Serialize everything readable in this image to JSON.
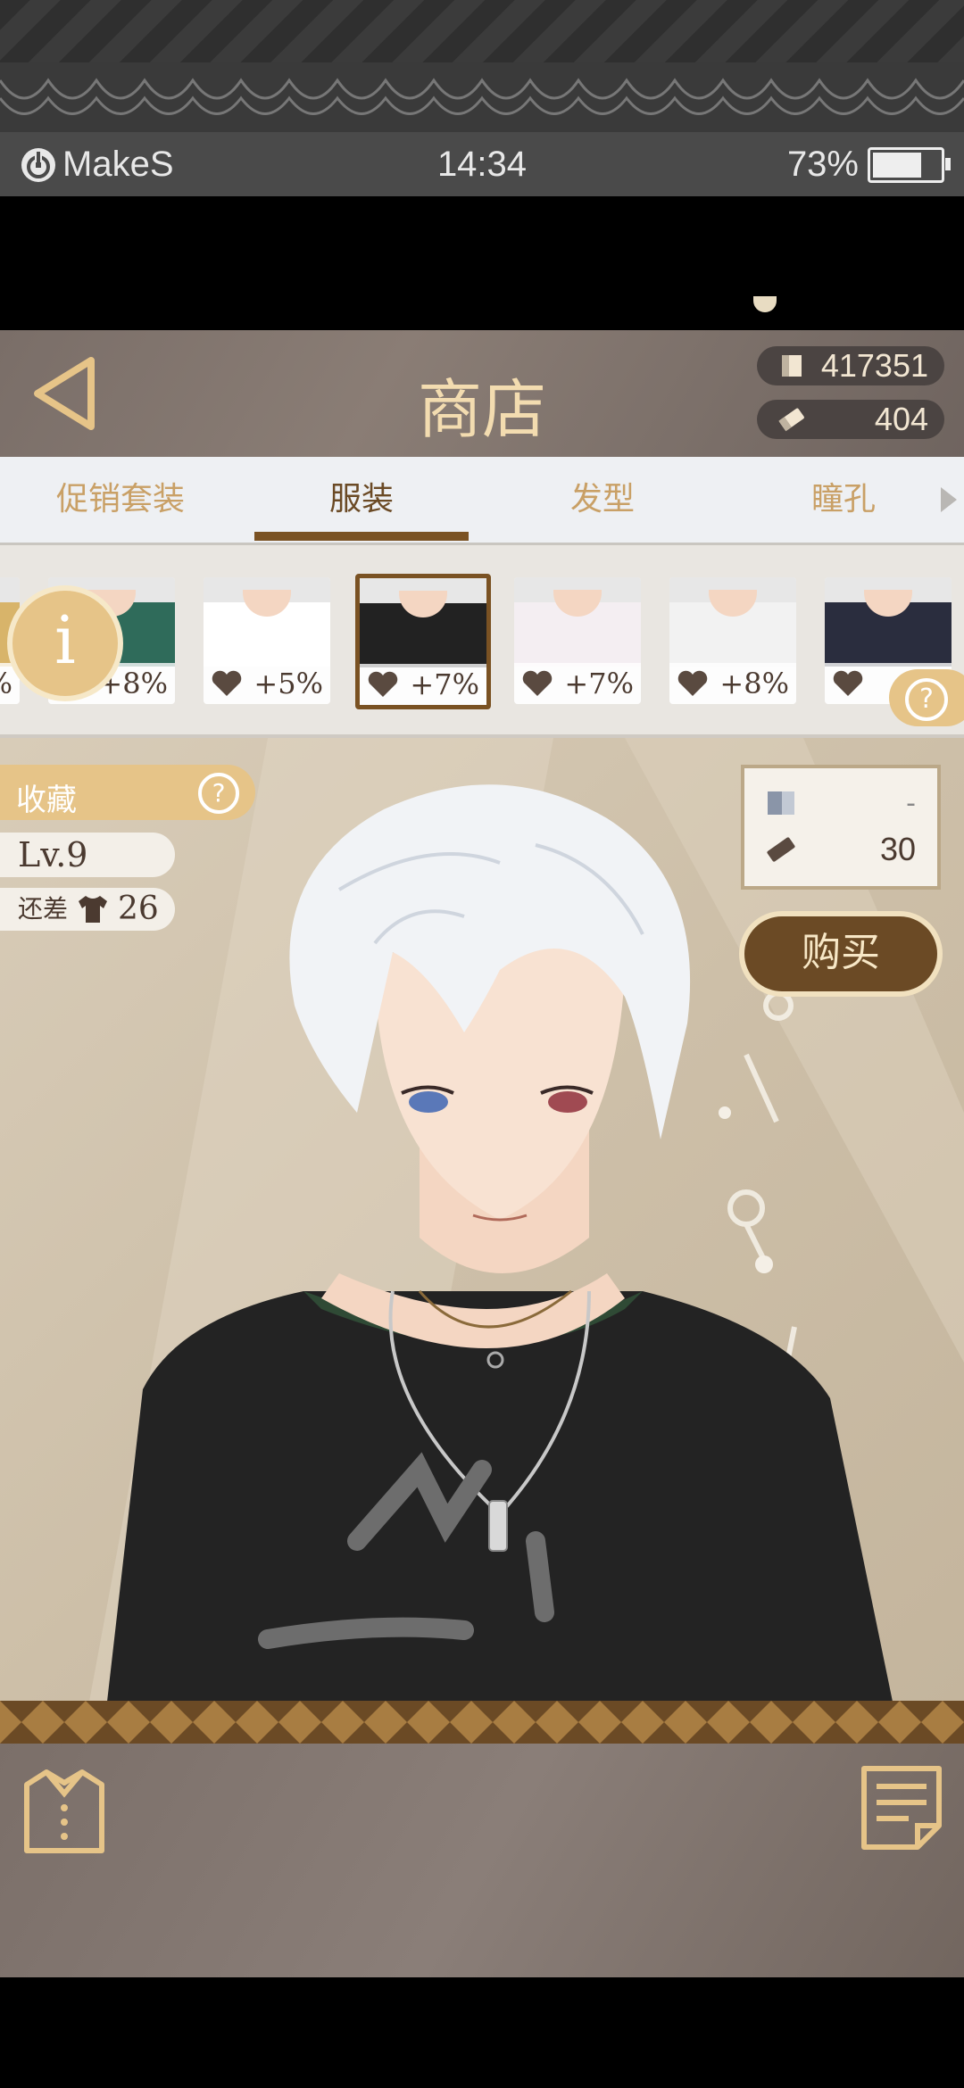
{
  "status_bar": {
    "brand": "MakeS",
    "time": "14:34",
    "battery": "73%",
    "battery_level": 0.73
  },
  "header": {
    "title": "商店",
    "currency_cards": "417351",
    "currency_tickets": "404"
  },
  "tabs": [
    {
      "label": "促销套装",
      "active": false
    },
    {
      "label": "服装",
      "active": true
    },
    {
      "label": "发型",
      "active": false
    },
    {
      "label": "瞳孔",
      "active": false
    }
  ],
  "items": [
    {
      "bonus": "%",
      "shirt_color": "#d8b46a",
      "partial": true
    },
    {
      "bonus": "+8%",
      "shirt_color": "#2f6b5a"
    },
    {
      "bonus": "+5%",
      "shirt_color": "#ffffff"
    },
    {
      "bonus": "+7%",
      "shirt_color": "#222222",
      "selected": true
    },
    {
      "bonus": "+7%",
      "shirt_color": "#f4eef2"
    },
    {
      "bonus": "+8%",
      "shirt_color": "#f2f2f2"
    },
    {
      "bonus": "+",
      "shirt_color": "#2a2d3e"
    }
  ],
  "info_label": "i",
  "help_label": "?",
  "collection": {
    "label": "收藏",
    "level": "Lv.9",
    "need_label": "还差",
    "need_count": "26"
  },
  "price": {
    "cards": "-",
    "tickets": "30"
  },
  "buy_label": "购买",
  "colors": {
    "accent": "#e6c488",
    "brown": "#6b4a25",
    "title": "#f3dcb0"
  }
}
